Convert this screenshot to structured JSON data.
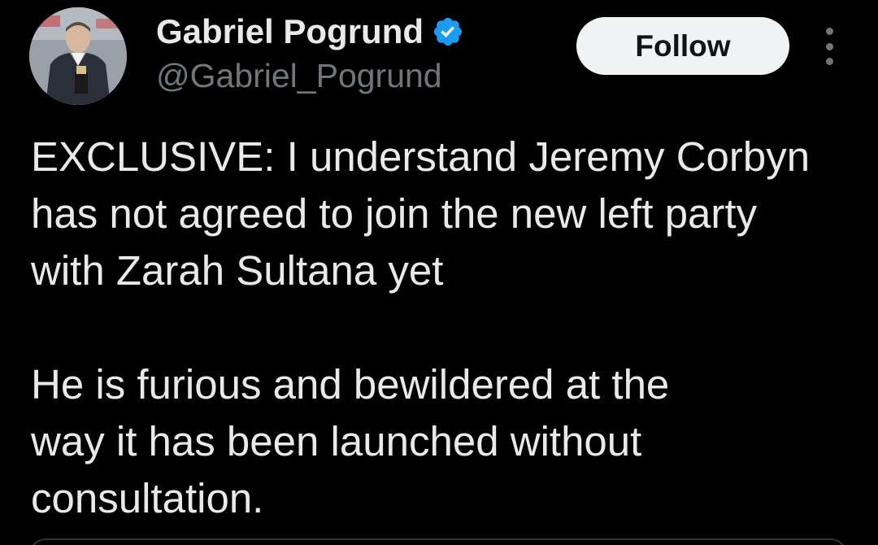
{
  "author": {
    "display_name": "Gabriel Pogrund",
    "handle": "@Gabriel_Pogrund",
    "verified": true,
    "verified_color": "#1d9bf0",
    "avatar_icon": "profile-photo"
  },
  "actions": {
    "follow_label": "Follow",
    "more_icon": "more-vertical-icon"
  },
  "tweet": {
    "paragraphs": [
      {
        "lines": [
          "EXCLUSIVE: I understand Jeremy Corbyn",
          "has not agreed to join the new left party",
          "with Zarah Sultana yet"
        ]
      },
      {
        "lines": [
          "He is furious and bewildered at the",
          "way it has been launched without",
          "consultation."
        ]
      }
    ]
  },
  "theme": {
    "background": "#000000",
    "text_primary": "#e7e9ea",
    "text_secondary": "#71767b",
    "button_bg": "#eff3f4",
    "button_text": "#0f1419"
  }
}
